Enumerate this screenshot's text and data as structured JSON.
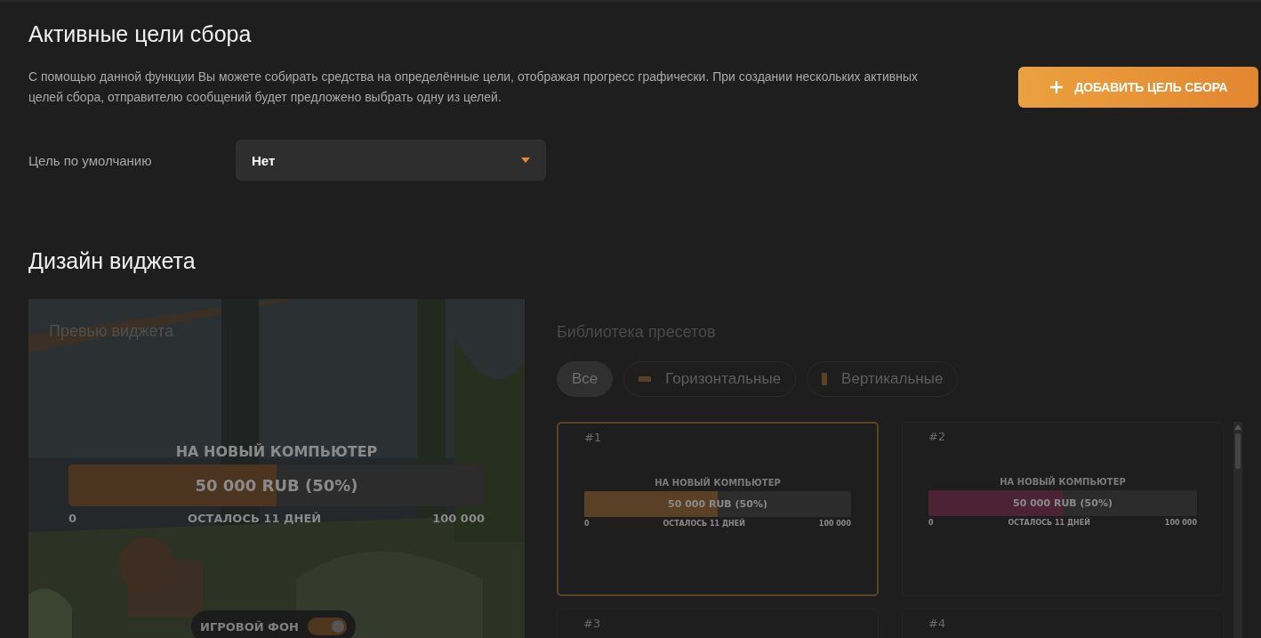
{
  "goals_title": "Активные цели сбора",
  "description": "С помощью данной функции Вы можете собирать средства на определённые цели, отображая прогресс графически. При создании нескольких активных целей сбора, отправителю сообщений будет предложено выбрать одну из целей.",
  "add_button": {
    "label": "ДОБАВИТЬ ЦЕЛЬ СБОРА"
  },
  "default_goal": {
    "label": "Цель по умолчанию",
    "value": "Нет"
  },
  "design_title": "Дизайн виджета",
  "preview": {
    "title": "Превью виджета",
    "widget": {
      "goal": "НА НОВЫЙ КОМПЬЮТЕР",
      "amount": "50 000 RUB (50%)",
      "level": 0.5,
      "color": "#4b3521",
      "min": "0",
      "remaining": "ОСТАЛОСЬ 11 ДНЕЙ",
      "max": "100 000"
    },
    "toggle": {
      "label": "ИГРОВОЙ ФОН",
      "on": true
    }
  },
  "library": {
    "title": "Библиотека пресетов",
    "filters": [
      {
        "label": "Все",
        "kind": "all",
        "selected": true
      },
      {
        "label": "Горизонтальные",
        "kind": "horizontal",
        "selected": false
      },
      {
        "label": "Вертикальные",
        "kind": "vertical",
        "selected": false
      }
    ],
    "presets": [
      {
        "number": "#1",
        "selected": true,
        "widget": {
          "goal": "НА НОВЫЙ КОМПЬЮТЕР",
          "amount": "50 000 RUB (50%)",
          "level": 0.5,
          "color": "#5a4126",
          "min": "0",
          "remaining": "ОСТАЛОСЬ 11 ДНЕЙ",
          "max": "100 000"
        }
      },
      {
        "number": "#2",
        "selected": false,
        "widget": {
          "goal": "НА НОВЫЙ КОМПЬЮТЕР",
          "amount": "50 000 RUB (50%)",
          "level": 0.5,
          "color": "#4b2334",
          "min": "0",
          "remaining": "ОСТАЛОСЬ 11 ДНЕЙ",
          "max": "100 000"
        }
      },
      {
        "number": "#3",
        "selected": false
      },
      {
        "number": "#4",
        "selected": false
      }
    ]
  }
}
